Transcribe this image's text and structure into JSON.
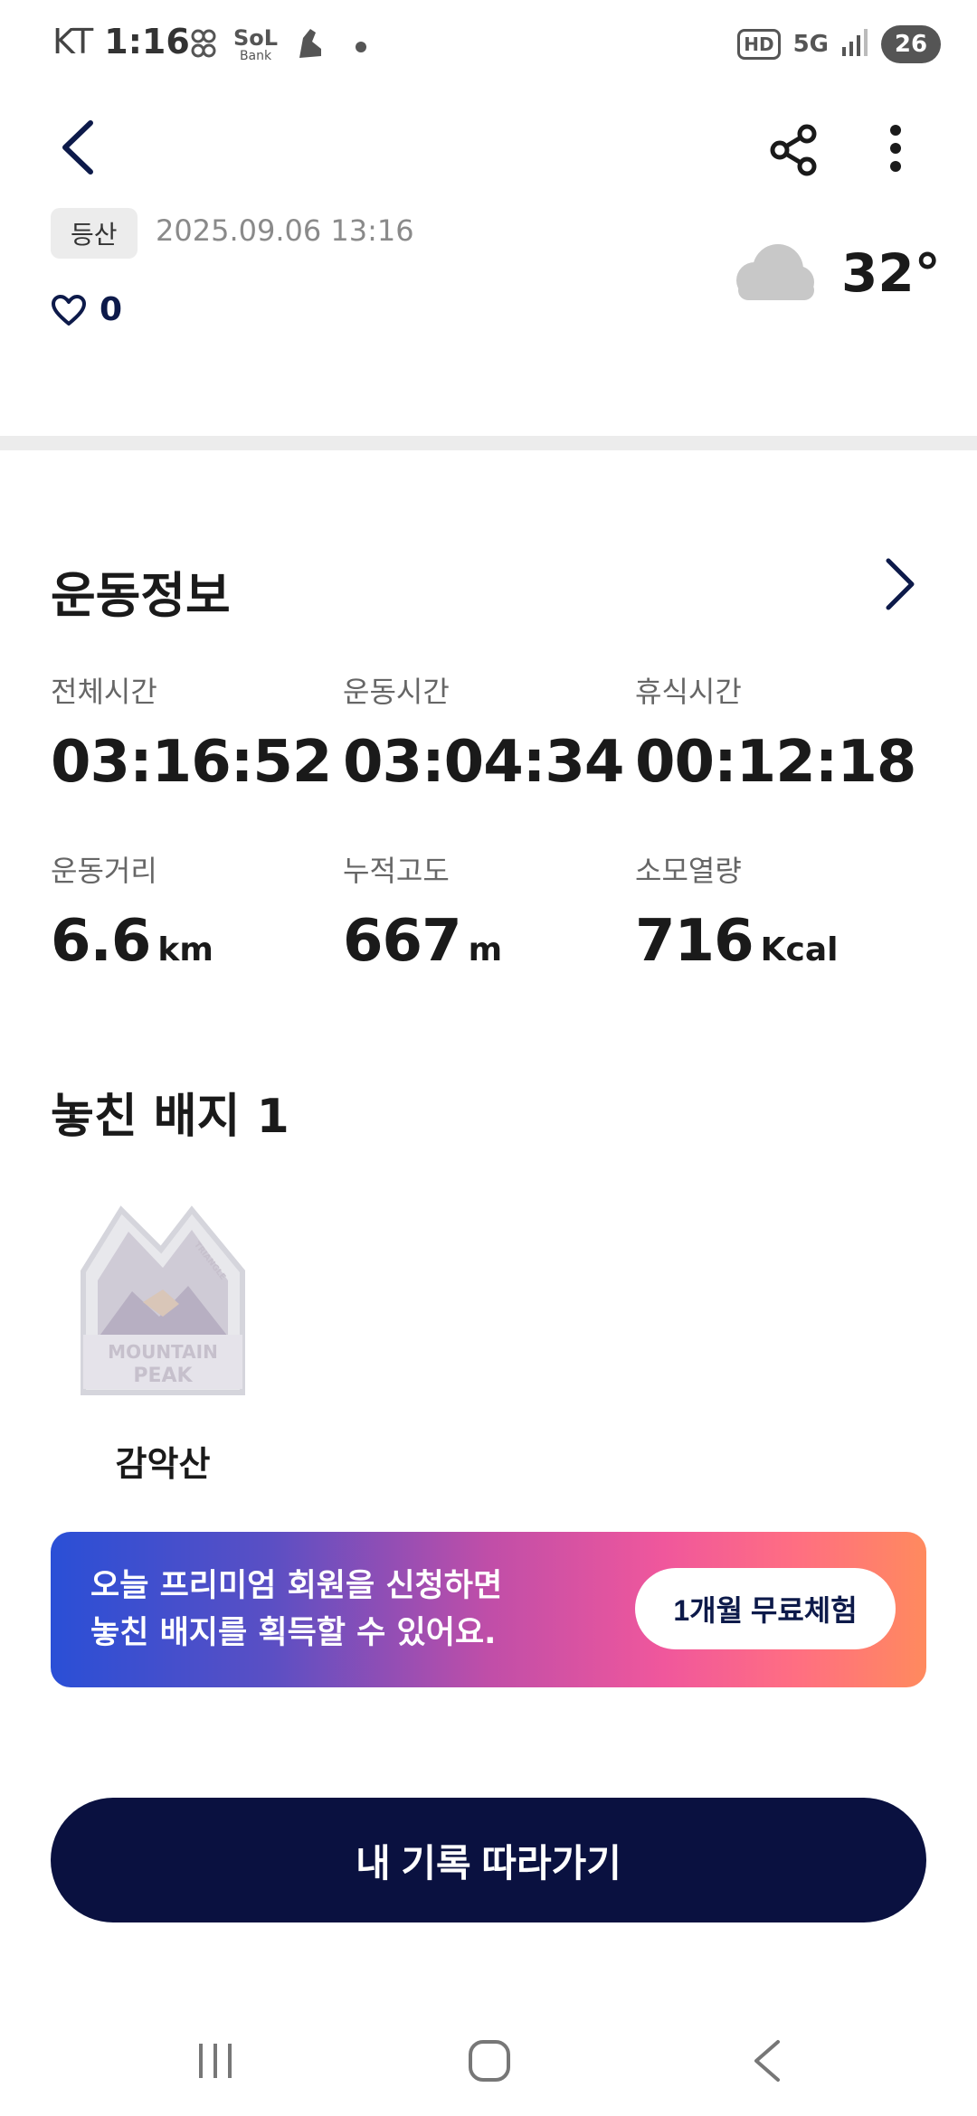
{
  "status_bar": {
    "carrier": "KT",
    "time": "1:16",
    "notification_icons": [
      "go-plus-icon",
      "sol-bank-icon",
      "running-shoe-icon"
    ],
    "sol_text": "SoL",
    "sol_sub": "Bank",
    "hd": "HD",
    "network": "5G",
    "battery": "26"
  },
  "header": {
    "activity_tag": "등산",
    "datetime": "2025.09.06 13:16",
    "likes": "0",
    "temperature": "32°",
    "weather_icon": "cloud-icon"
  },
  "exercise": {
    "title": "운동정보",
    "metrics": [
      {
        "label": "전체시간",
        "value": "03:16:52",
        "unit": ""
      },
      {
        "label": "운동시간",
        "value": "03:04:34",
        "unit": ""
      },
      {
        "label": "휴식시간",
        "value": "00:12:18",
        "unit": ""
      },
      {
        "label": "운동거리",
        "value": "6.6",
        "unit": "km"
      },
      {
        "label": "누적고도",
        "value": "667",
        "unit": "m"
      },
      {
        "label": "소모열량",
        "value": "716",
        "unit": "Kcal"
      }
    ]
  },
  "badges": {
    "title": "놓친 배지 1",
    "items": [
      {
        "name": "감악산",
        "badge_line1": "MOUNTAIN",
        "badge_line2": "PEAK",
        "badge_top": "TRIANGLE"
      }
    ]
  },
  "promo": {
    "line1": "오늘 프리미엄 회원을 신청하면",
    "line2": "놓친 배지를 획득할 수 있어요.",
    "button": "1개월 무료체험"
  },
  "cta": {
    "label": "내 기록 따라가기"
  },
  "colors": {
    "navy": "#0a1140",
    "accent_text": "#0d1a4a",
    "promo_start": "#2a4fd6",
    "promo_mid": "#f0579c",
    "promo_end": "#ff8a5e"
  }
}
